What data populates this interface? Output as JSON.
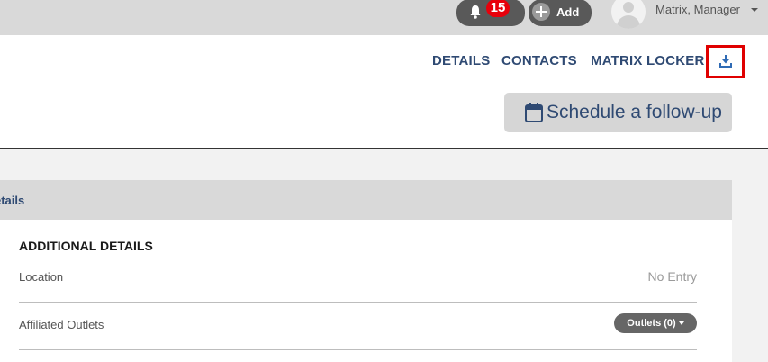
{
  "header": {
    "notifications": {
      "count": "15",
      "icon": "bell-icon"
    },
    "add_label": "Add",
    "user_name": "Matrix, Manager"
  },
  "nav": {
    "details": "DETAILS",
    "contacts": "CONTACTS",
    "locker": "MATRIX LOCKER",
    "download_icon": "download-icon",
    "highlight_color": "#e00000"
  },
  "followup": {
    "label": "Schedule a follow-up",
    "icon": "calendar-icon"
  },
  "panel": {
    "header_title": "etails",
    "section_title": "ADDITIONAL DETAILS",
    "rows": [
      {
        "label": "Location",
        "value": "No Entry"
      },
      {
        "label": "Affiliated Outlets",
        "button": "Outlets (0)"
      }
    ]
  },
  "colors": {
    "accent": "#2f4a73",
    "badge": "#e8000b",
    "topbar": "#d9d9d9"
  }
}
